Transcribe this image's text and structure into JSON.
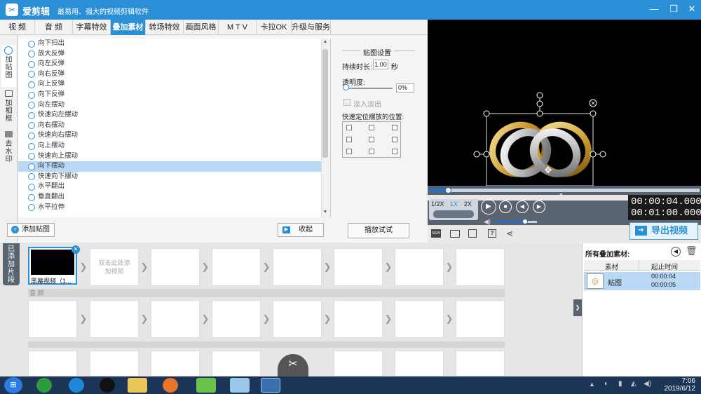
{
  "app": {
    "name": "爱剪辑",
    "slogan": "最易用、强大的视频剪辑软件",
    "logo": "scissors-logo-icon"
  },
  "tabs": [
    "视 频",
    "音 频",
    "字幕特效",
    "叠加素材",
    "转场特效",
    "画面风格",
    "M T V",
    "卡拉OK",
    "升级与服务"
  ],
  "sidebar": [
    "加贴图",
    "加相框",
    "去水印"
  ],
  "effects": [
    "向下扫出",
    "放大反弹",
    "向左反弹",
    "向右反弹",
    "向上反弹",
    "向下反弹",
    "向左摆动",
    "快速向左摆动",
    "向右摆动",
    "快速向右摆动",
    "向上摆动",
    "快速向上摆动",
    "向下摆动",
    "快速向下摆动",
    "水平翻出",
    "垂直翻出",
    "水平拉伸"
  ],
  "buttons": {
    "add_sticker": "添加贴图",
    "collapse": "收起",
    "preview": "播放试试",
    "export": "导出视频"
  },
  "settings": {
    "title": "贴图设置",
    "duration_label": "持续时长:",
    "duration_value": "1.00",
    "duration_unit": "秒",
    "opacity_label": "透明度:",
    "opacity_value": "0%",
    "fade_label": "淡入淡出",
    "position_label": "快速定位摆放的位置:"
  },
  "player": {
    "speeds": [
      "1/2X",
      "1X",
      "2X"
    ],
    "time_current": "00:00:04.000",
    "time_total": "00:01:00.000",
    "progress": 0.07,
    "volume": 0.72
  },
  "timeline": {
    "vertical_label": "已添加片段",
    "clip1_label": "黑幕视频（1...",
    "hint": "双击此处添加视频",
    "audio_label": "音 频"
  },
  "rightpanel": {
    "title": "所有叠加素材:",
    "col1": "素材",
    "col2": "起止时间",
    "row_name": "贴图",
    "row_start": "00:00:04",
    "row_end": "00:00:05"
  },
  "taskbar": {
    "time": "7:06",
    "date": "2019/6/12"
  },
  "colors": {
    "accent": "#2a8fd6",
    "selected": "#b8d8f5"
  }
}
